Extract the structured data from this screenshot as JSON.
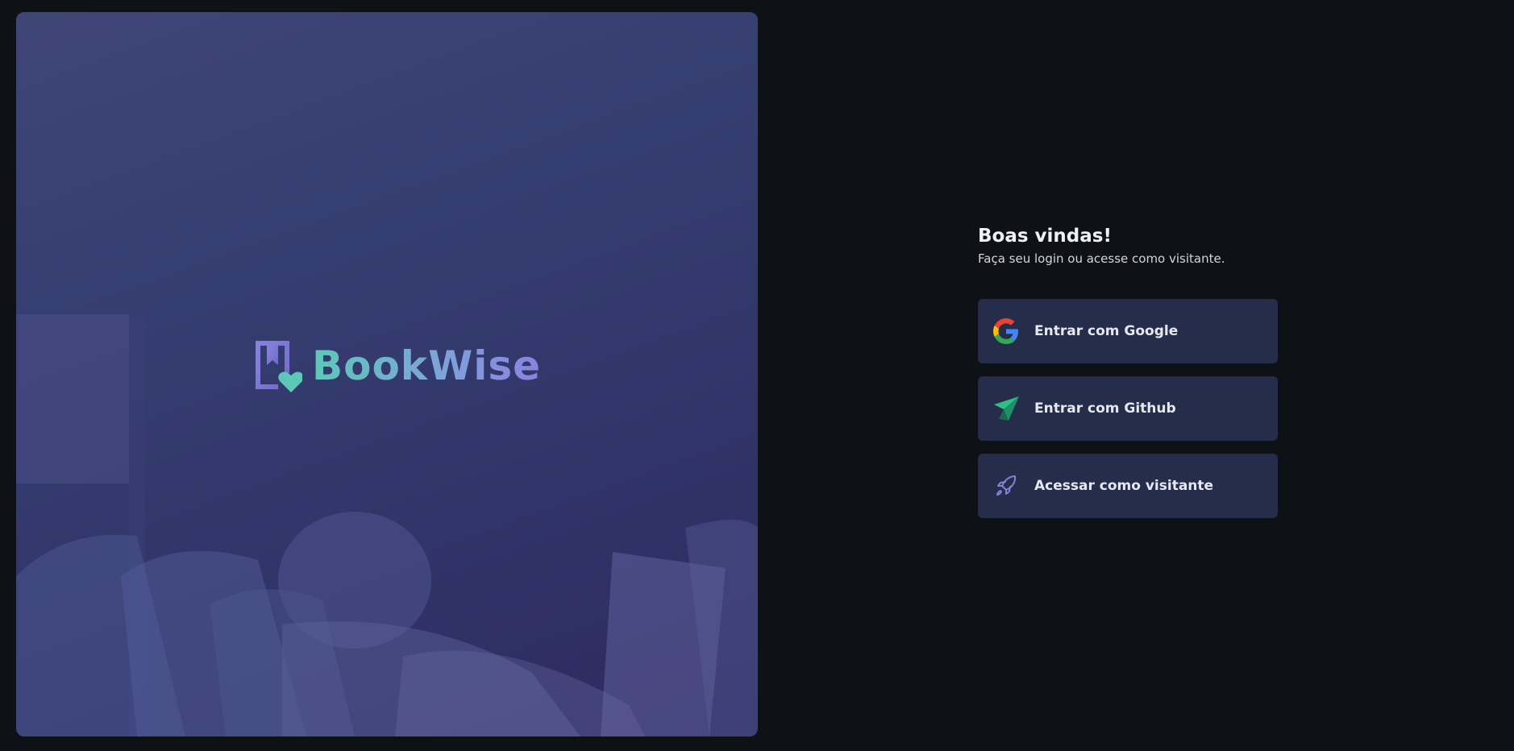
{
  "brand": {
    "name": "BookWise"
  },
  "login": {
    "title": "Boas vindas!",
    "subtitle": "Faça seu login ou acesse como visitante.",
    "buttons": [
      {
        "label": "Entrar com Google",
        "icon": "google-icon"
      },
      {
        "label": "Entrar com Github",
        "icon": "github-icon"
      },
      {
        "label": "Acessar como visitante",
        "icon": "rocket-icon"
      }
    ]
  },
  "colors": {
    "background": "#0e1116",
    "button": "#252d4a",
    "accent_green": "#50b2a0",
    "accent_purple": "#8381d9"
  }
}
